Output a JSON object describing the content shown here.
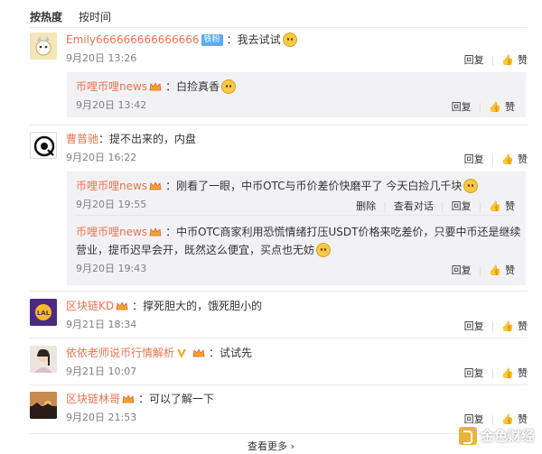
{
  "sort": {
    "hot": "按热度",
    "time": "按时间"
  },
  "actions": {
    "reply": "回复",
    "like": "赞",
    "delete": "删除",
    "view_thread": "查看对话"
  },
  "comments": [
    {
      "user": "Emily666666666666666",
      "badge": "铁粉",
      "text": "：我去试试",
      "time": "9月20日 13:26",
      "replies": [
        {
          "user": "币哩币哩news",
          "text": "：白捡真香",
          "time": "9月20日 13:42"
        }
      ]
    },
    {
      "user": "曹普驰",
      "text": "：提不出来的，内盘",
      "time": "9月20日 16:22",
      "replies": [
        {
          "user": "币哩币哩news",
          "text": "：刚看了一眼，中币OTC与币价差价快磨平了 今天白捡几千块",
          "time": "9月20日 19:55"
        },
        {
          "user": "币哩币哩news",
          "text": "：中币OTC商家利用恐慌情绪打压USDT价格来吃差价，只要中币还是继续",
          "text2": "营业，提币迟早会开，既然这么便宜，买点也无妨",
          "time": "9月20日 19:43"
        }
      ]
    },
    {
      "user": "区块链KD",
      "text": "：撑死胆大的，饿死胆小的",
      "time": "9月21日 18:34"
    },
    {
      "user": "依依老师说币行情解析",
      "text": "：试试先",
      "time": "9月21日 10:07"
    },
    {
      "user": "区块链林哥",
      "text": "：可以了解一下",
      "time": "9月20日 21:53"
    }
  ],
  "footer": {
    "more": "查看更多 ›"
  },
  "watermark": {
    "text": "金色财经"
  },
  "colors": {
    "username": "#eb7350",
    "reply_bg": "#f2f2f5",
    "meta": "#808080"
  }
}
